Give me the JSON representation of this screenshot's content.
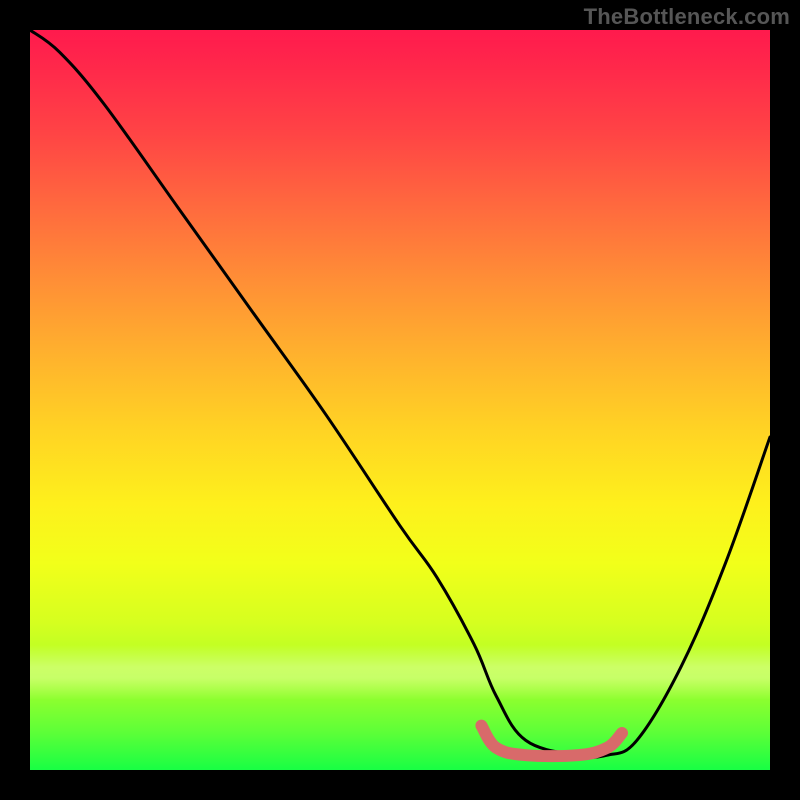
{
  "watermark": "TheBottleneck.com",
  "chart_data": {
    "type": "line",
    "title": "",
    "xlabel": "",
    "ylabel": "",
    "xlim": [
      0,
      100
    ],
    "ylim": [
      0,
      100
    ],
    "grid": false,
    "series": [
      {
        "name": "curve",
        "color": "#000000",
        "x": [
          0,
          4,
          10,
          20,
          30,
          40,
          50,
          55,
          60,
          63,
          67,
          74,
          78,
          82,
          88,
          94,
          100
        ],
        "values": [
          100,
          97,
          90,
          76,
          62,
          48,
          33,
          26,
          17,
          10,
          4,
          2,
          2,
          4,
          14,
          28,
          45
        ]
      },
      {
        "name": "flat-bottom-highlight",
        "color": "#d86a6a",
        "x": [
          61,
          63,
          67,
          74,
          78,
          80
        ],
        "values": [
          6,
          3,
          2,
          2,
          3,
          5
        ]
      }
    ],
    "background_gradient": {
      "direction": "vertical",
      "stops": [
        {
          "pos": 0.0,
          "color": "#ff1a4d"
        },
        {
          "pos": 0.3,
          "color": "#ff7a38"
        },
        {
          "pos": 0.55,
          "color": "#ffd324"
        },
        {
          "pos": 0.75,
          "color": "#f2ff1a"
        },
        {
          "pos": 1.0,
          "color": "#18ff44"
        }
      ]
    }
  }
}
